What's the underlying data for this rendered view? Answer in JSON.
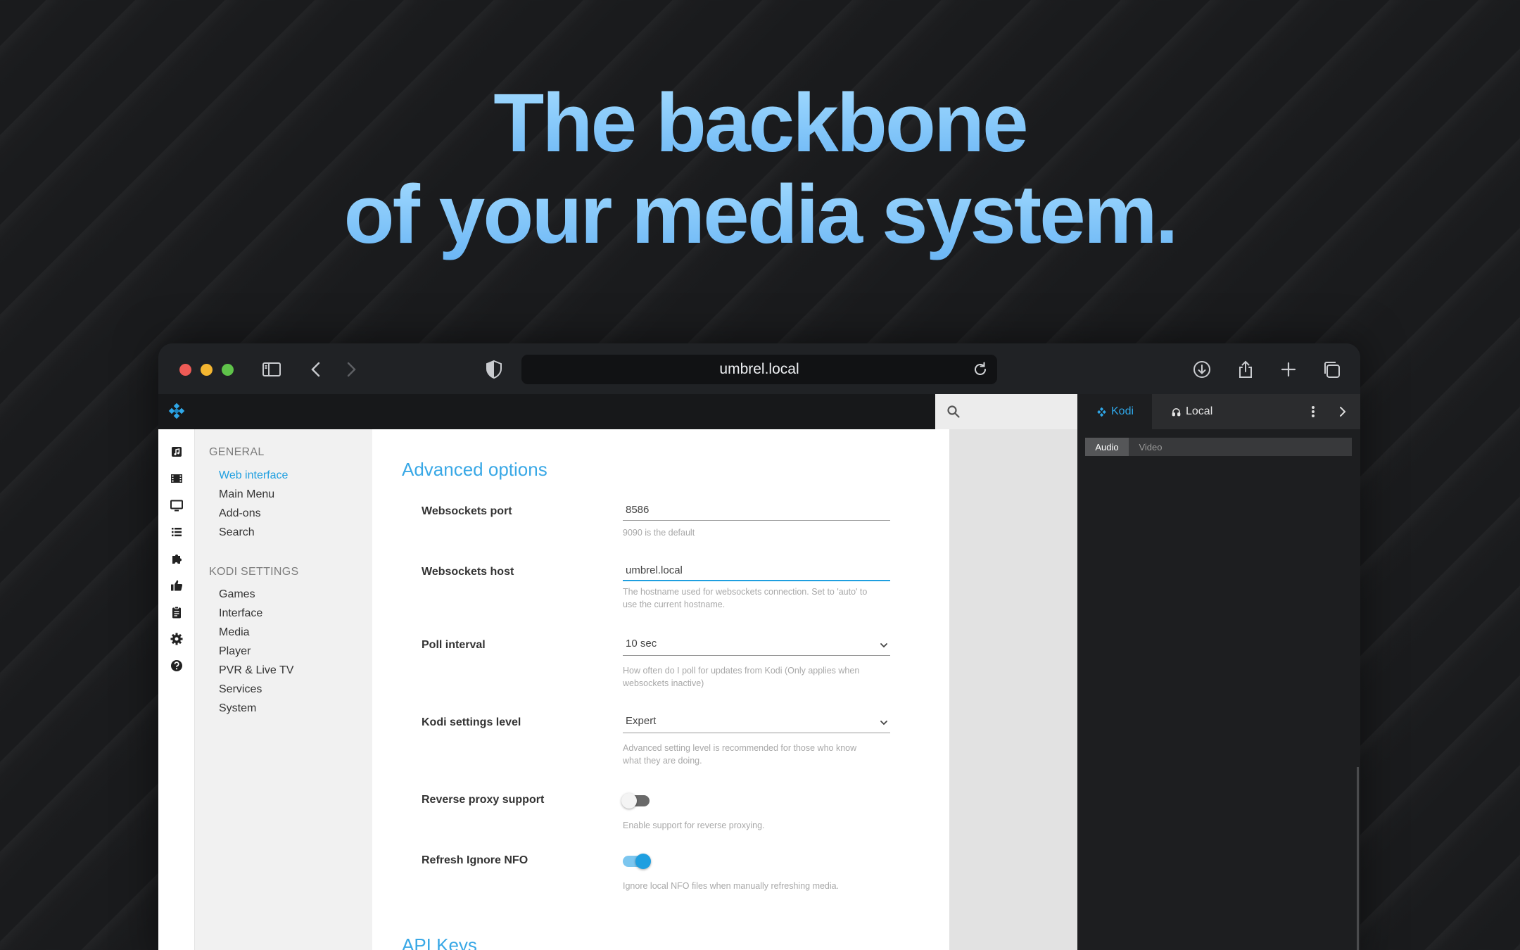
{
  "hero": {
    "line1": "The backbone",
    "line2": "of your media system."
  },
  "browser": {
    "url": "umbrel.local",
    "icons": [
      "sidebar-toggle-icon",
      "back-icon",
      "forward-icon",
      "shield-icon",
      "reload-icon",
      "download-icon",
      "share-icon",
      "new-tab-icon",
      "tabs-overview-icon"
    ]
  },
  "rightpanel": {
    "tabs": {
      "kodi": "Kodi",
      "local": "Local"
    },
    "subtabs": {
      "audio": "Audio",
      "video": "Video"
    }
  },
  "nav": {
    "general_heading": "GENERAL",
    "general_items": [
      "Web interface",
      "Main Menu",
      "Add-ons",
      "Search"
    ],
    "kodi_heading": "KODI SETTINGS",
    "kodi_items": [
      "Games",
      "Interface",
      "Media",
      "Player",
      "PVR & Live TV",
      "Services",
      "System"
    ]
  },
  "rail_icons": [
    "music-icon",
    "movies-icon",
    "tv-icon",
    "playlist-icon",
    "addons-icon",
    "thumbs-up-icon",
    "clipboard-icon",
    "settings-icon",
    "help-icon"
  ],
  "settings": {
    "section_title": "Advanced options",
    "websockets_port": {
      "label": "Websockets port",
      "value": "8586",
      "hint": "9090 is the default"
    },
    "websockets_host": {
      "label": "Websockets host",
      "value": "umbrel.local",
      "hint_line1": "The hostname used for websockets connection. Set to 'auto' to",
      "hint_line2": "use the current hostname."
    },
    "poll_interval": {
      "label": "Poll interval",
      "value": "10 sec",
      "hint_line1": "How often do I poll for updates from Kodi (Only applies when",
      "hint_line2": "websockets inactive)"
    },
    "settings_level": {
      "label": "Kodi settings level",
      "value": "Expert",
      "hint_line1": "Advanced setting level is recommended for those who know",
      "hint_line2": "what they are doing."
    },
    "reverse_proxy": {
      "label": "Reverse proxy support",
      "enabled": false,
      "hint": "Enable support for reverse proxying."
    },
    "refresh_ignore_nfo": {
      "label": "Refresh Ignore NFO",
      "enabled": true,
      "hint": "Ignore local NFO files when manually refreshing media."
    },
    "next_section_title": "API Keys"
  },
  "colors": {
    "accent": "#1f9fe0",
    "heading_gradient_top": "#a4dcff",
    "heading_gradient_bottom": "#6bb6f5"
  }
}
